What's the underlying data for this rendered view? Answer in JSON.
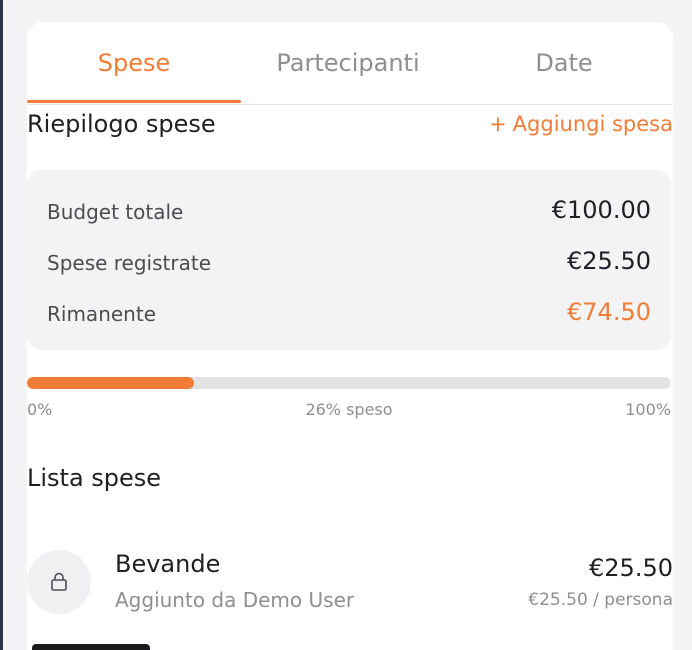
{
  "tabs": [
    {
      "label": "Spese",
      "active": true
    },
    {
      "label": "Partecipanti",
      "active": false
    },
    {
      "label": "Date",
      "active": false
    }
  ],
  "summary": {
    "title": "Riepilogo spese",
    "add_label": "Aggiungi spesa",
    "add_icon": "+",
    "rows": [
      {
        "label": "Budget totale",
        "value": "€100.00"
      },
      {
        "label": "Spese registrate",
        "value": "€25.50"
      },
      {
        "label": "Rimanente",
        "value": "€74.50"
      }
    ]
  },
  "progress": {
    "percent": 26,
    "start_label": "0%",
    "middle_label": "26% speso",
    "end_label": "100%"
  },
  "expenses": {
    "title": "Lista spese",
    "items": [
      {
        "name": "Bevande",
        "added_by": "Aggiunto da Demo User",
        "amount": "€25.50",
        "per_person": "€25.50 / persona",
        "icon": "bag-icon"
      }
    ]
  },
  "colors": {
    "accent": "#f07c35",
    "text": "#1f1f24",
    "muted": "#8e8e93",
    "surface": "#f3f3f4"
  }
}
